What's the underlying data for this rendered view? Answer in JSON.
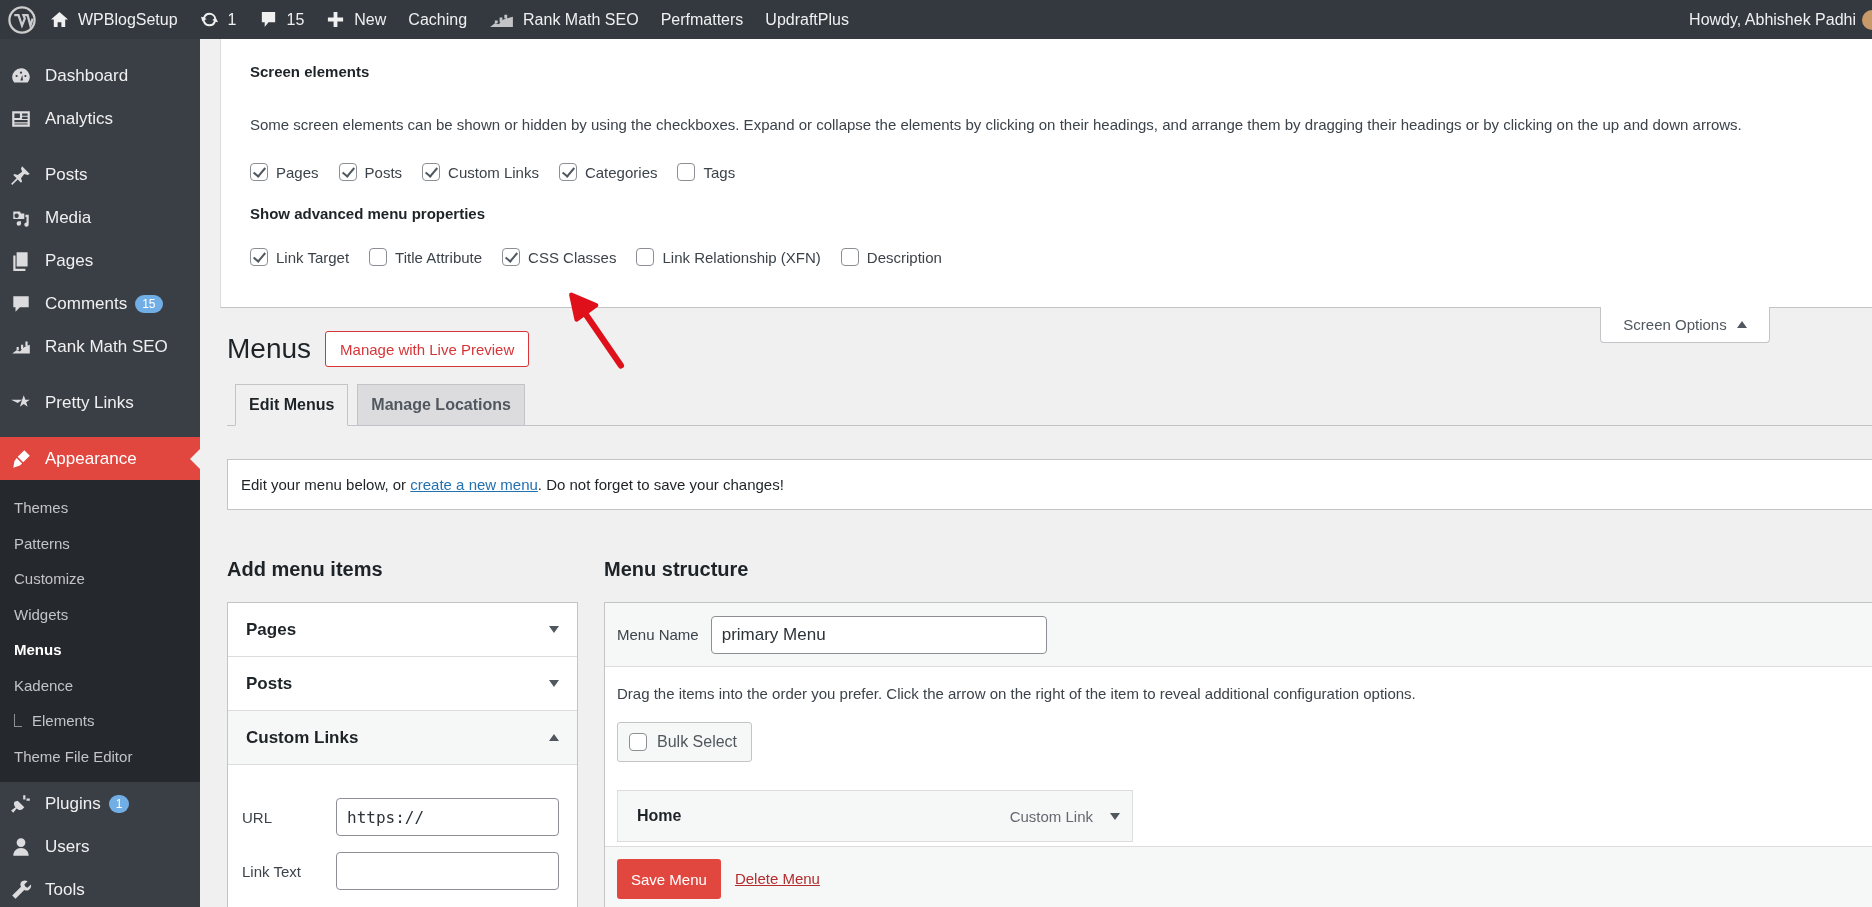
{
  "admin_bar": {
    "items": [
      {
        "label": "WPBlogSetup"
      },
      {
        "label": "1"
      },
      {
        "label": "15"
      },
      {
        "label": "New"
      },
      {
        "label": "Caching"
      },
      {
        "label": "Rank Math SEO"
      },
      {
        "label": "Perfmatters"
      },
      {
        "label": "UpdraftPlus"
      }
    ],
    "greeting": "Howdy, Abhishek Padhi"
  },
  "sidebar": {
    "groups": [
      [
        {
          "label": "Dashboard",
          "selected": false
        },
        {
          "label": "Analytics",
          "selected": false
        }
      ],
      [
        {
          "label": "Posts",
          "selected": false
        },
        {
          "label": "Media",
          "selected": false
        },
        {
          "label": "Pages",
          "selected": false
        },
        {
          "label": "Comments",
          "selected": false,
          "badge": "15"
        },
        {
          "label": "Rank Math SEO",
          "selected": false
        }
      ],
      [
        {
          "label": "Pretty Links",
          "selected": false
        }
      ],
      [
        {
          "label": "Appearance",
          "selected": true,
          "children": [
            {
              "label": "Themes",
              "selected": false
            },
            {
              "label": "Patterns",
              "selected": false
            },
            {
              "label": "Customize",
              "selected": false
            },
            {
              "label": "Widgets",
              "selected": false
            },
            {
              "label": "Menus",
              "selected": true
            },
            {
              "label": "Kadence",
              "selected": false,
              "children": [
                {
                  "label": "Elements",
                  "selected": false
                }
              ]
            },
            {
              "label": "Theme File Editor",
              "selected": false
            }
          ]
        },
        {
          "label": "Plugins",
          "selected": false,
          "badge": "1"
        },
        {
          "label": "Users",
          "selected": false
        },
        {
          "label": "Tools",
          "selected": false
        }
      ]
    ]
  },
  "screen_options": {
    "heading": "Screen elements",
    "description": "Some screen elements can be shown or hidden by using the checkboxes. Expand or collapse the elements by clicking on their headings, and arrange them by dragging their headings or by clicking on the up and down arrows.",
    "boxes": [
      {
        "label": "Pages",
        "checked": true
      },
      {
        "label": "Posts",
        "checked": true
      },
      {
        "label": "Custom Links",
        "checked": true
      },
      {
        "label": "Categories",
        "checked": true
      },
      {
        "label": "Tags",
        "checked": false
      }
    ],
    "advanced_heading": "Show advanced menu properties",
    "advanced": [
      {
        "label": "Link Target",
        "checked": true
      },
      {
        "label": "Title Attribute",
        "checked": false
      },
      {
        "label": "CSS Classes",
        "checked": true
      },
      {
        "label": "Link Relationship (XFN)",
        "checked": false
      },
      {
        "label": "Description",
        "checked": false
      }
    ],
    "toggle": {
      "label": "Screen Options",
      "expanded": true
    }
  },
  "title": "Menus",
  "live_preview_button": "Manage with Live Preview",
  "tabs": [
    {
      "label": "Edit Menus",
      "selected": true
    },
    {
      "label": "Manage Locations",
      "selected": false
    }
  ],
  "notice": {
    "before": "Edit your menu below, or ",
    "link": "create a new menu",
    "after": ". Do not forget to save your changes!"
  },
  "add_menu_items": {
    "heading": "Add menu items",
    "sections": [
      {
        "title": "Pages",
        "expanded": false
      },
      {
        "title": "Posts",
        "expanded": false
      },
      {
        "title": "Custom Links",
        "expanded": true
      }
    ],
    "url_label": "URL",
    "url_value": "https://",
    "link_text_label": "Link Text"
  },
  "menu_structure": {
    "heading": "Menu structure",
    "menu_name_label": "Menu Name",
    "menu_name": "primary Menu",
    "instructions": "Drag the items into the order you prefer. Click the arrow on the right of the item to reveal additional configuration options.",
    "bulk_select": {
      "label": "Bulk Select",
      "checked": false
    },
    "items": [
      {
        "title": "Home",
        "type": "Custom Link"
      }
    ],
    "save": "Save Menu",
    "delete": "Delete Menu"
  }
}
